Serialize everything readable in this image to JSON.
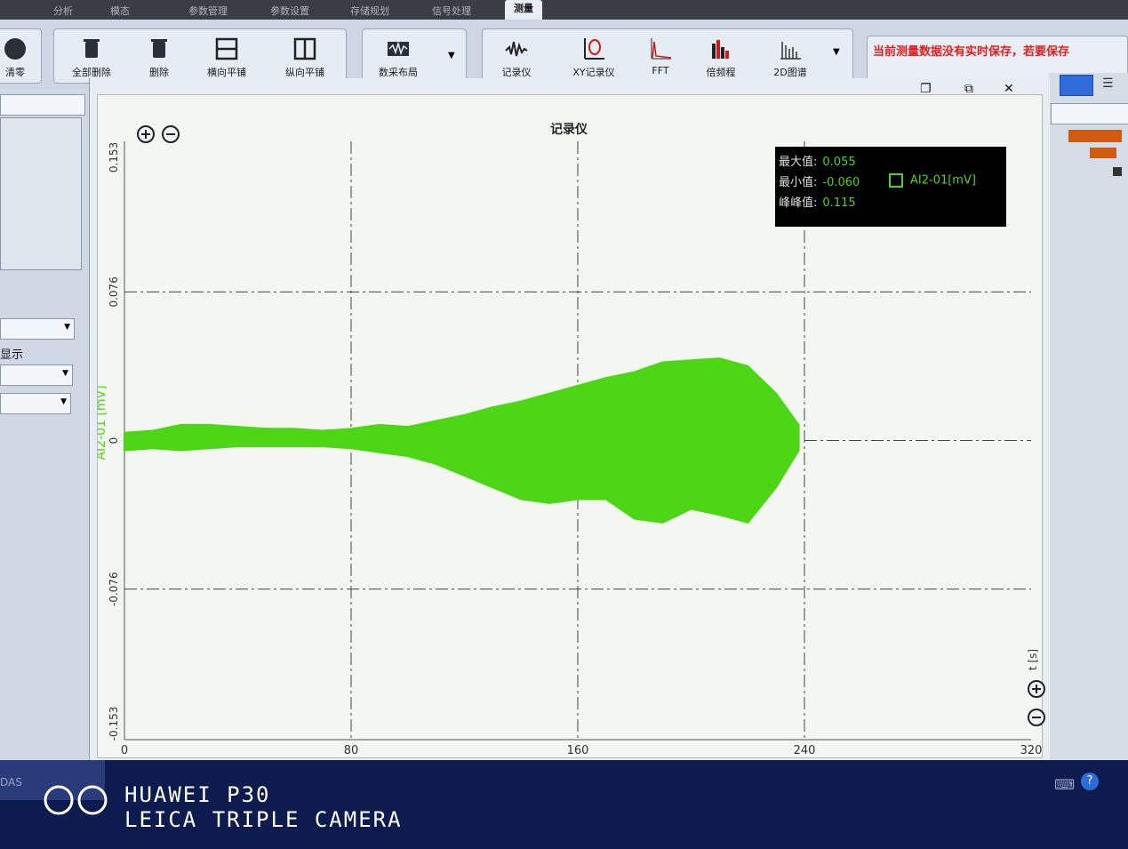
{
  "ribbon": {
    "tabs": [
      "分析",
      "模态",
      "参数管理",
      "参数设置",
      "存储规划",
      "信号处理",
      "测量"
    ],
    "active_tab": "测量",
    "tools": {
      "zero": "清零",
      "delete_all": "全部删除",
      "delete": "删除",
      "tile_horizontal": "横向平铺",
      "tile_vertical": "纵向平铺",
      "acq_layout": "数采布局",
      "recorder": "记录仪",
      "xy_recorder": "XY记录仪",
      "fft": "FFT",
      "octave": "倍频程",
      "spectrum_2d": "2D图谱"
    },
    "warning": "当前测量数据没有实时保存，若要保存"
  },
  "left_panel": {
    "display_label": "显示"
  },
  "chart_window": {
    "title": "记录仪"
  },
  "legend": {
    "max_label": "最大值:",
    "max_value": "0.055",
    "min_label": "最小值:",
    "min_value": "-0.060",
    "pp_label": "峰峰值:",
    "pp_value": "0.115",
    "series_name": "AI2-01[mV]"
  },
  "chart_data": {
    "type": "line",
    "title": "记录仪",
    "xlabel": "t [s]",
    "ylabel": "AI2-01 [mV]",
    "xlim": [
      0,
      320
    ],
    "ylim": [
      -0.153,
      0.153
    ],
    "x_ticks": [
      "0",
      "80",
      "160",
      "240",
      "320"
    ],
    "y_ticks": [
      "0.153",
      "0.076",
      "0",
      "-0.076",
      "-0.153"
    ],
    "grid": true,
    "legend_position": "top-right",
    "series_color": "#4cd616",
    "series": [
      {
        "name": "AI2-01[mV]",
        "x": [
          0,
          10,
          20,
          30,
          40,
          50,
          60,
          70,
          80,
          90,
          100,
          110,
          120,
          130,
          140,
          150,
          160,
          170,
          180,
          190,
          200,
          210,
          220,
          230,
          238
        ],
        "ymax": [
          0.004,
          0.005,
          0.008,
          0.008,
          0.007,
          0.006,
          0.006,
          0.005,
          0.006,
          0.008,
          0.007,
          0.01,
          0.013,
          0.017,
          0.02,
          0.024,
          0.028,
          0.032,
          0.035,
          0.04,
          0.041,
          0.042,
          0.038,
          0.024,
          0.008
        ],
        "ymin": [
          -0.005,
          -0.004,
          -0.005,
          -0.004,
          -0.003,
          -0.003,
          -0.003,
          -0.003,
          -0.004,
          -0.006,
          -0.008,
          -0.012,
          -0.018,
          -0.024,
          -0.03,
          -0.032,
          -0.03,
          -0.03,
          -0.04,
          -0.042,
          -0.035,
          -0.038,
          -0.042,
          -0.024,
          -0.005
        ]
      }
    ]
  }
}
